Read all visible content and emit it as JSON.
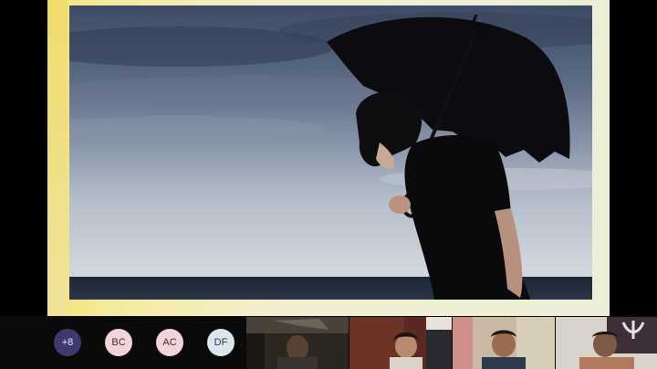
{
  "shared_screen": {
    "image_icon": "umbrella-photo"
  },
  "participants": {
    "overflow_label": "+8",
    "avatars": [
      {
        "initials": "BC"
      },
      {
        "initials": "AC"
      },
      {
        "initials": "DF"
      }
    ],
    "video_tiles": [
      {
        "name": ""
      },
      {
        "name": ""
      },
      {
        "name": ""
      },
      {
        "name": ""
      }
    ]
  },
  "colors": {
    "overflow_avatar": "#3e3a6e",
    "initials_avatar": "#f3d3da",
    "df_avatar": "#d9e6ec",
    "slide_accent": "#f1e27a"
  }
}
